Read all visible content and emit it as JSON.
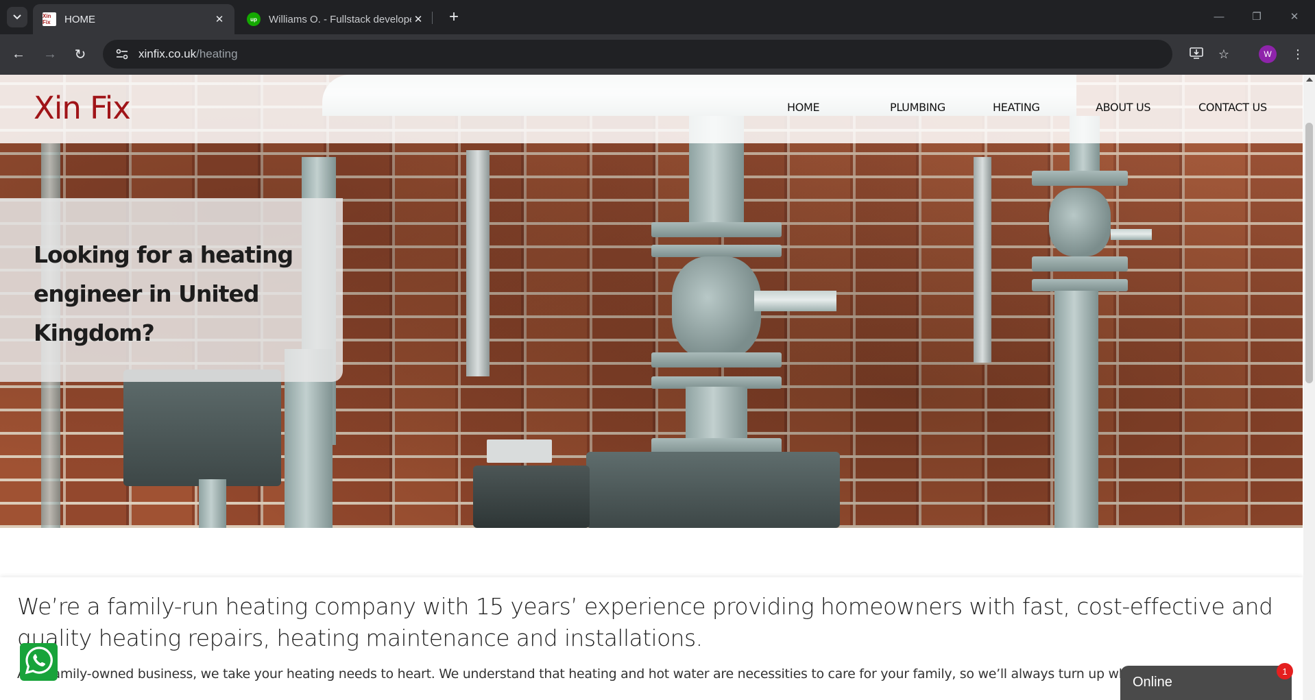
{
  "browser": {
    "tabs": [
      {
        "title": "HOME",
        "favicon": "Xin Fix",
        "active": true
      },
      {
        "title": "Williams O. - Fullstack developer",
        "favicon": "up",
        "active": false
      }
    ],
    "url_host": "xinfix.co.uk",
    "url_path": "/heating",
    "profile_initial": "W"
  },
  "site": {
    "logo": "Xin Fix",
    "nav": [
      "HOME",
      "PLUMBING",
      "HEATING",
      "ABOUT US",
      "CONTACT US"
    ],
    "hero_heading": "Looking for a heating engineer in United Kingdom?",
    "intro": "We’re a family-run heating company with 15 years’ experience providing homeowners with fast, cost-effective and quality heating repairs, heating maintenance and installations.",
    "body": "As a family-owned business, we take your heating needs to heart. We understand that heating and hot water are necessities to care for your family, so we’ll always turn up when we say we will."
  },
  "chat": {
    "status": "Online",
    "badge_count": "1"
  },
  "colors": {
    "brand": "#a01418",
    "whatsapp": "#18a33a",
    "chat_bg": "#4a4a4a",
    "badge": "#e41f1f"
  }
}
